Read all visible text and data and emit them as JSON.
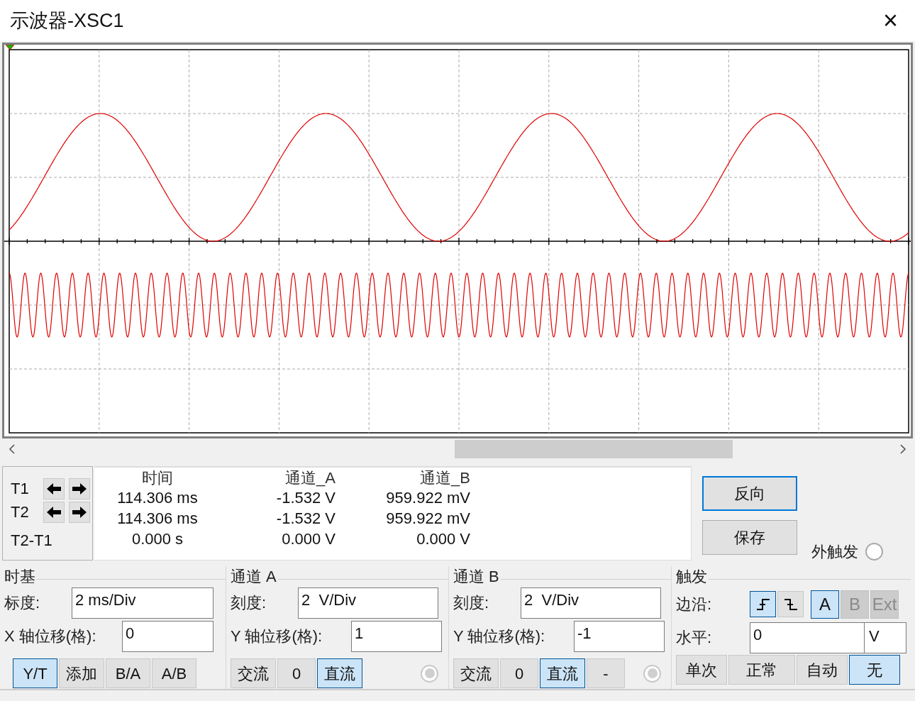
{
  "window": {
    "title": "示波器-XSC1",
    "close": "×"
  },
  "readout": {
    "cursor_labels": [
      "T1",
      "T2",
      "T2-T1"
    ],
    "columns": [
      "时间",
      "通道_A",
      "通道_B"
    ],
    "rows": [
      [
        "114.306 ms",
        "-1.532 V",
        "959.922 mV"
      ],
      [
        "114.306 ms",
        "-1.532 V",
        "959.922 mV"
      ],
      [
        "0.000 s",
        "0.000 V",
        "0.000 V"
      ]
    ]
  },
  "actions": [
    {
      "label": "反向",
      "selected": true
    },
    {
      "label": "保存",
      "selected": false
    }
  ],
  "external_trigger": {
    "label": "外触发",
    "selected": false
  },
  "timebase": {
    "title": "时基",
    "scale_label": "标度:",
    "scale_value": "2 ms/Div",
    "offset_label": "X 轴位移(格):",
    "offset_value": "0",
    "modes": [
      {
        "label": "Y/T",
        "selected": true
      },
      {
        "label": "添加",
        "selected": false
      },
      {
        "label": "B/A",
        "selected": false
      },
      {
        "label": "A/B",
        "selected": false
      }
    ]
  },
  "channels": [
    {
      "title": "通道 A",
      "scale_label": "刻度:",
      "scale_value": "2  V/Div",
      "offset_label": "Y 轴位移(格):",
      "offset_value": "1",
      "couplings": [
        {
          "label": "交流",
          "selected": false
        },
        {
          "label": "0",
          "selected": false
        },
        {
          "label": "直流",
          "selected": true
        }
      ],
      "radio_selected": true
    },
    {
      "title": "通道 B",
      "scale_label": "刻度:",
      "scale_value": "2  V/Div",
      "offset_label": "Y 轴位移(格):",
      "offset_value": "-1",
      "couplings": [
        {
          "label": "交流",
          "selected": false
        },
        {
          "label": "0",
          "selected": false
        },
        {
          "label": "直流",
          "selected": true
        },
        {
          "label": "-",
          "selected": false
        }
      ],
      "radio_selected": true
    }
  ],
  "trigger": {
    "title": "触发",
    "edge_label": "边沿:",
    "edges": [
      {
        "kind": "rising",
        "selected": true
      },
      {
        "kind": "falling",
        "selected": false
      }
    ],
    "sources": [
      {
        "label": "A",
        "selected": true,
        "disabled": false
      },
      {
        "label": "B",
        "selected": false,
        "disabled": true
      },
      {
        "label": "Ext",
        "selected": false,
        "disabled": true
      }
    ],
    "level_label": "水平:",
    "level_value": "0",
    "level_unit": "V",
    "modes": [
      {
        "label": "单次",
        "selected": false
      },
      {
        "label": "正常",
        "selected": false
      },
      {
        "label": "自动",
        "selected": false
      },
      {
        "label": "无",
        "selected": true
      }
    ]
  }
}
